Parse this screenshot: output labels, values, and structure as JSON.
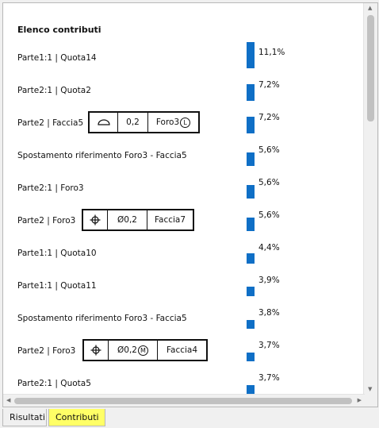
{
  "list": {
    "title": "Elenco contributi",
    "rows": [
      {
        "label": "Parte1:1 | Quota14",
        "percent": "11,1%",
        "value": 11.1
      },
      {
        "label": "Parte2:1 | Quota2",
        "percent": "7,2%",
        "value": 7.2
      },
      {
        "label": "Parte2 | Faccia5",
        "percent": "7,2%",
        "value": 7.2,
        "fcf": {
          "symbol": "profile-of-surface-icon",
          "tolerance": "0,2",
          "datum": "Foro3",
          "datum_modifier": "L"
        }
      },
      {
        "label": "Spostamento riferimento Foro3 - Faccia5",
        "percent": "5,6%",
        "value": 5.6
      },
      {
        "label": "Parte2:1 | Foro3",
        "percent": "5,6%",
        "value": 5.6
      },
      {
        "label": "Parte2 | Foro3",
        "percent": "5,6%",
        "value": 5.6,
        "fcf": {
          "symbol": "position-icon",
          "diameter": "Ø",
          "tolerance": "0,2",
          "datum": "Faccia7"
        }
      },
      {
        "label": "Parte1:1 | Quota10",
        "percent": "4,4%",
        "value": 4.4
      },
      {
        "label": "Parte1:1 | Quota11",
        "percent": "3,9%",
        "value": 3.9
      },
      {
        "label": "Spostamento riferimento Foro3 - Faccia5",
        "percent": "3,8%",
        "value": 3.8
      },
      {
        "label": "Parte2 | Foro3",
        "percent": "3,7%",
        "value": 3.7,
        "fcf": {
          "symbol": "position-icon",
          "diameter": "Ø",
          "tolerance": "0,2",
          "tolerance_modifier": "M",
          "datum": "Faccia4"
        }
      },
      {
        "label": "Parte2:1 | Quota5",
        "percent": "3,7%",
        "value": 3.7
      }
    ]
  },
  "tabs": [
    {
      "label": "Risultati",
      "active": false
    },
    {
      "label": "Contributi",
      "active": true
    }
  ],
  "colors": {
    "bar": "#0f6fc6",
    "active_tab": "#ffff66"
  }
}
